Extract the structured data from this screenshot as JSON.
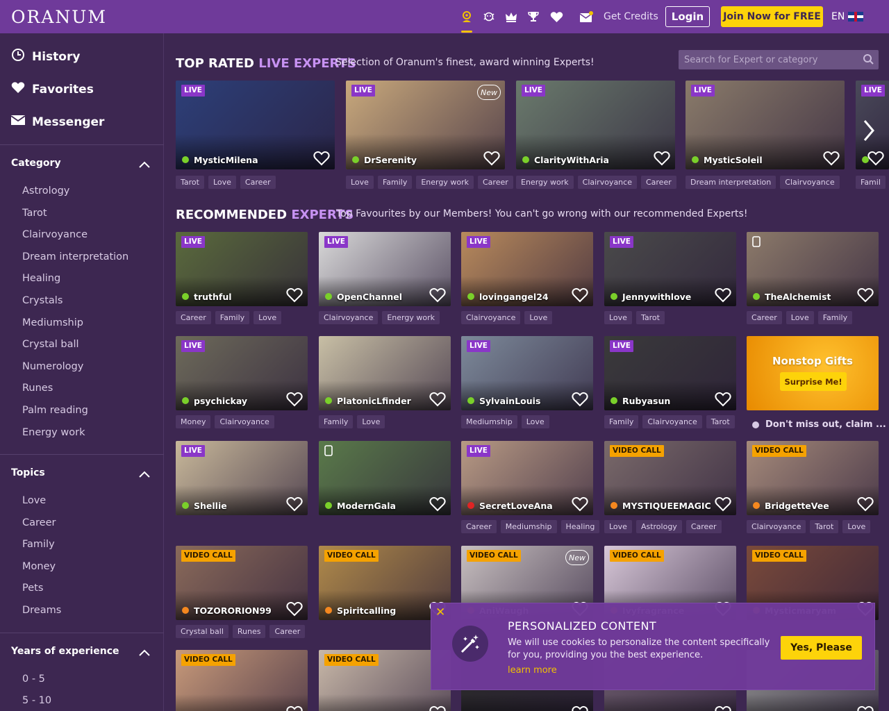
{
  "header": {
    "logo": "ORANUM",
    "get_credits": "Get Credits",
    "login": "Login",
    "join": "Join Now for FREE",
    "lang": "EN",
    "icons": [
      "psychic-icon",
      "mask-icon",
      "crown-icon",
      "trophy-icon",
      "heart-icon",
      "mail-icon"
    ],
    "accent": "#f2c200"
  },
  "sidebar": {
    "nav": [
      {
        "label": "History",
        "icon": "history-icon"
      },
      {
        "label": "Favorites",
        "icon": "heart-icon"
      },
      {
        "label": "Messenger",
        "icon": "mail-icon"
      }
    ],
    "category": {
      "title": "Category",
      "items": [
        "Astrology",
        "Tarot",
        "Clairvoyance",
        "Dream interpretation",
        "Healing",
        "Crystals",
        "Mediumship",
        "Crystal ball",
        "Numerology",
        "Runes",
        "Palm reading",
        "Energy work"
      ]
    },
    "topics": {
      "title": "Topics",
      "items": [
        "Love",
        "Career",
        "Family",
        "Money",
        "Pets",
        "Dreams"
      ]
    },
    "experience": {
      "title": "Years of experience",
      "items": [
        "0 - 5",
        "5 - 10"
      ]
    }
  },
  "top_rated": {
    "title_a": "TOP RATED",
    "title_b": "LIVE EXPERTS",
    "subtitle": "Selection of Oranum's finest, award winning Experts!",
    "search_placeholder": "Search for Expert or category",
    "cards": [
      {
        "name": "MysticMilena",
        "badge": "LIVE",
        "status": "online",
        "tags": [
          "Tarot",
          "Love",
          "Career"
        ],
        "bg": "#2d3f78"
      },
      {
        "name": "DrSerenity",
        "badge": "LIVE",
        "new": "New",
        "status": "online",
        "tags": [
          "Love",
          "Family",
          "Energy work",
          "Career"
        ],
        "bg": "#c9a97c"
      },
      {
        "name": "ClarityWithAria",
        "badge": "LIVE",
        "status": "online",
        "tags": [
          "Energy work",
          "Clairvoyance",
          "Career"
        ],
        "bg": "#6a7a6c"
      },
      {
        "name": "MysticSoleil",
        "badge": "LIVE",
        "status": "online",
        "tags": [
          "Dream interpretation",
          "Clairvoyance"
        ],
        "bg": "#8a7b6a"
      },
      {
        "name": "",
        "badge": "LIVE",
        "status": "online",
        "tags": [
          "Famil"
        ],
        "bg": "#4a4a5a"
      }
    ]
  },
  "recommended": {
    "title_a": "RECOMMENDED",
    "title_b": "EXPERTS",
    "subtitle": "Top Favourites by our Members! You can't go wrong with our recommended Experts!",
    "rows": [
      [
        {
          "name": "truthful",
          "badge": "LIVE",
          "status": "online",
          "tags": [
            "Career",
            "Family",
            "Love"
          ],
          "bg": "#5a6a3c"
        },
        {
          "name": "OpenChannel",
          "badge": "LIVE",
          "status": "online",
          "tags": [
            "Clairvoyance",
            "Energy work"
          ],
          "bg": "#d9d9d9"
        },
        {
          "name": "lovingangel24",
          "badge": "LIVE",
          "status": "online",
          "tags": [
            "Clairvoyance",
            "Love"
          ],
          "bg": "#b88a5c"
        },
        {
          "name": "Jennywithlove",
          "badge": "LIVE",
          "status": "online",
          "tags": [
            "Love",
            "Tarot"
          ],
          "bg": "#4a4a4a"
        },
        {
          "name": "TheAlchemist",
          "badge": "phone",
          "status": "online",
          "tags": [
            "Career",
            "Love",
            "Family"
          ],
          "bg": "#8c7a6a"
        }
      ],
      [
        {
          "name": "psychickay",
          "badge": "LIVE",
          "status": "online",
          "tags": [
            "Money",
            "Clairvoyance"
          ],
          "bg": "#6d6a5a"
        },
        {
          "name": "PlatonicLfinder",
          "badge": "",
          "status": "online",
          "tags": [
            "Family",
            "Love"
          ],
          "bg": "#c8bfa5"
        },
        {
          "name": "SylvainLouis",
          "badge": "LIVE",
          "status": "online",
          "tags": [
            "Mediumship",
            "Love"
          ],
          "bg": "#7d8a9a"
        },
        {
          "name": "Rubyasun",
          "badge": "LIVE",
          "status": "online",
          "tags": [
            "Family",
            "Clairvoyance",
            "Tarot"
          ],
          "bg": "#3a3a3a"
        }
      ],
      [
        {
          "name": "Shellie",
          "badge": "LIVE",
          "status": "online",
          "tags": [],
          "bg": "#c8b89a"
        },
        {
          "name": "ModernGala",
          "badge": "phone",
          "status": "online",
          "tags": [],
          "bg": "#5a7a4a"
        },
        {
          "name": "SecretLoveAna",
          "badge": "LIVE",
          "status": "busy",
          "tags": [
            "Career",
            "Mediumship",
            "Healing"
          ],
          "bg": "#b89a84"
        },
        {
          "name": "MYSTIQUEEMAGIC",
          "badge": "VIDEO CALL",
          "status": "away",
          "tags": [
            "Love",
            "Astrology",
            "Career"
          ],
          "bg": "#7a6a6a"
        },
        {
          "name": "BridgetteVee",
          "badge": "VIDEO CALL",
          "status": "away",
          "tags": [
            "Clairvoyance",
            "Tarot",
            "Love"
          ],
          "bg": "#a58a7a"
        }
      ],
      [
        {
          "name": "TOZORORION99",
          "badge": "VIDEO CALL",
          "status": "away",
          "tags": [
            "Crystal ball",
            "Runes",
            "Career"
          ],
          "bg": "#8a6a5a"
        },
        {
          "name": "Spiritcalling",
          "badge": "VIDEO CALL",
          "status": "away",
          "tags": [],
          "bg": "#b08a4a"
        },
        {
          "name": "AniWaugh",
          "badge": "VIDEO CALL",
          "new": "New",
          "status": "away",
          "tags": [],
          "bg": "#c8c0c0"
        },
        {
          "name": "Ivyfragrance",
          "badge": "VIDEO CALL",
          "status": "away",
          "tags": [],
          "bg": "#d8c8d8"
        },
        {
          "name": "Mysticmaryam",
          "badge": "VIDEO CALL",
          "status": "away",
          "tags": [],
          "bg": "#7a4a3a"
        }
      ],
      [
        {
          "name": "",
          "badge": "VIDEO CALL",
          "status": "away",
          "tags": [],
          "bg": "#c89a7a"
        },
        {
          "name": "",
          "badge": "VIDEO CALL",
          "status": "away",
          "tags": [],
          "bg": "#c8b8a8"
        },
        {
          "name": "",
          "badge": "",
          "status": "away",
          "tags": [],
          "bg": "#2a2a2a"
        },
        {
          "name": "",
          "badge": "",
          "status": "away",
          "tags": [],
          "bg": "#6a5a6a"
        },
        {
          "name": "",
          "badge": "",
          "status": "away",
          "tags": [],
          "bg": "#8a8a8a"
        }
      ]
    ],
    "gift": {
      "title": "Nonstop Gifts",
      "button": "Surprise Me!",
      "note": "Don't miss out, claim ..."
    }
  },
  "cookie": {
    "close": "✕",
    "title": "PERSONALIZED CONTENT",
    "text": "We will use cookies to personalize the content specifically for you, providing you the best experience.",
    "link": "learn more",
    "button": "Yes, Please"
  },
  "colors": {
    "header_bg": "#6f3a9a",
    "page_bg": "#3d2751",
    "accent_yellow": "#fdd30a",
    "live_badge": "#8a36c8",
    "video_badge": "#f5a200",
    "online": "#7ad02a",
    "busy": "#e02424",
    "away": "#f5881f"
  }
}
